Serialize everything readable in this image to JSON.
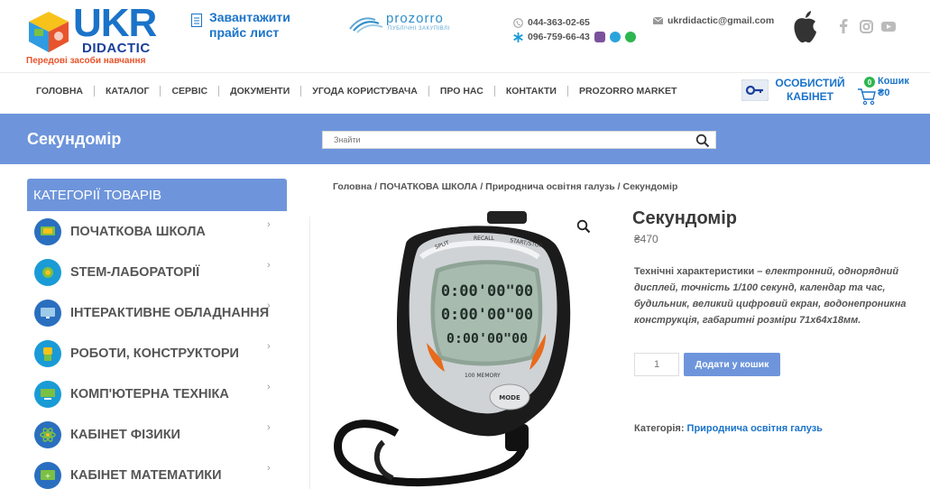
{
  "header": {
    "logo": {
      "brand_line1": "UKR",
      "brand_line2": "DIDACTIC",
      "tagline": "Передові засоби навчання"
    },
    "price_list": "Завантажити прайс лист",
    "prozorro": {
      "name": "prozorro",
      "subtitle": "ПУБЛІЧНІ ЗАКУПІВЛІ"
    },
    "phone1": "044-363-02-65",
    "phone2": "096-759-66-43",
    "email": "ukrdidactic@gmail.com",
    "icons": [
      "apple-icon",
      "facebook-icon",
      "instagram-icon",
      "youtube-icon"
    ]
  },
  "nav": {
    "items": [
      "ГОЛОВНА",
      "КАТАЛОГ",
      "СЕРВІС",
      "ДОКУМЕНТИ",
      "УГОДА КОРИСТУВАЧА",
      "ПРО НАС",
      "КОНТАКТИ",
      "PROZORRO MARKET"
    ],
    "cabinet_line1": "ОСОБИСТИЙ",
    "cabinet_line2": "КАБІНЕТ",
    "cart_count": "0",
    "cart_label": "Кошик",
    "cart_total": "₴0"
  },
  "titlebar": {
    "title": "Секундомір",
    "search_placeholder": "Знайти"
  },
  "sidebar": {
    "heading": "КАТЕГОРІЇ ТОВАРІВ",
    "items": [
      {
        "label": "ПОЧАТКОВА ШКОЛА",
        "color": "#2a6fbf"
      },
      {
        "label": "STEM-ЛАБОРАТОРІЇ",
        "color": "#1a9bd6"
      },
      {
        "label": "ІНТЕРАКТИВНЕ ОБЛАДНАННЯ",
        "color": "#2a6fbf"
      },
      {
        "label": "РОБОТИ, КОНСТРУКТОРИ",
        "color": "#1a9bd6"
      },
      {
        "label": "КОМП'ЮТЕРНА ТЕХНІКА",
        "color": "#1a9bd6"
      },
      {
        "label": "КАБІНЕТ ФІЗИКИ",
        "color": "#2a6fbf"
      },
      {
        "label": "КАБІНЕТ МАТЕМАТИКИ",
        "color": "#2a6fbf"
      }
    ]
  },
  "product": {
    "breadcrumb": "Головна / ПОЧАТКОВА ШКОЛА / Природнича освітня галузь / Секундомір",
    "title": "Секундомір",
    "price": "₴470",
    "desc_label": "Технічні характеристики",
    "desc_text": " – електронний, однорядний дисплей,  точність 1/100 секунд,  календар та час,  будильник, великий цифровий екран, водонепроникна конструкція, габаритні розміри 71х64х18мм.",
    "quantity": "1",
    "add_to_cart": "Додати у кошик",
    "category_label": "Категорія:",
    "category_value": "Природнича освітня галузь",
    "display_rows": [
      "0:00'00\"00",
      "0:00'00\"00",
      "0:00'00\"00"
    ],
    "bezel_labels": [
      "SPLIT",
      "RECALL",
      "START/STOP",
      "100 MEMORY",
      "MODE"
    ]
  }
}
